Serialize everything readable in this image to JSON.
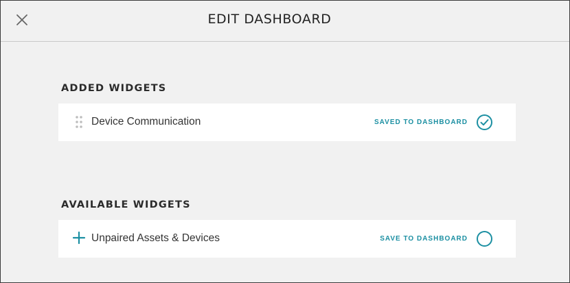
{
  "header": {
    "title": "EDIT DASHBOARD",
    "close_icon": "close-icon"
  },
  "added": {
    "title": "ADDED WIDGETS",
    "items": [
      {
        "name": "Device Communication",
        "status": "SAVED TO DASHBOARD",
        "saved": true,
        "icon": "drag-handle-icon"
      }
    ]
  },
  "available": {
    "title": "AVAILABLE WIDGETS",
    "items": [
      {
        "name": "Unpaired Assets & Devices",
        "status": "SAVE TO DASHBOARD",
        "saved": false,
        "icon": "plus-icon"
      }
    ]
  },
  "colors": {
    "accent": "#1b8fa2",
    "background": "#f1f1f1",
    "card": "#ffffff"
  }
}
